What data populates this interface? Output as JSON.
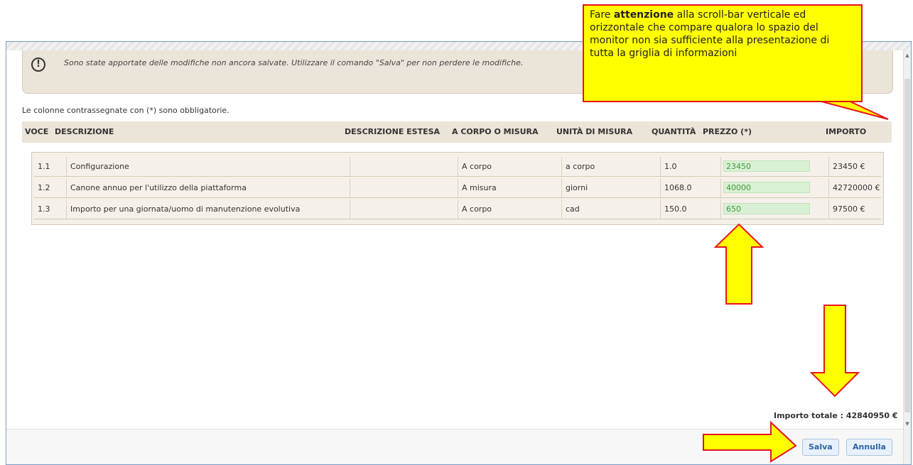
{
  "warning": {
    "message": "Sono state apportate delle modifiche non ancora salvate. Utilizzare il comando \"Salva\" per non perdere le modifiche.",
    "icon": "exclamation-circle-icon"
  },
  "note": "Le colonne contrassegnate con (*) sono obbligatorie.",
  "table": {
    "columns": [
      "VOCE",
      "DESCRIZIONE",
      "DESCRIZIONE ESTESA",
      "A CORPO O MISURA",
      "UNITÀ  DI  MISURA",
      "QUANTITÀ",
      "PREZZO (*)",
      "IMPORTO"
    ],
    "rows": [
      {
        "voce": "1.1",
        "descrizione": "Configurazione",
        "estesa": "",
        "corpo_misura": "A corpo",
        "unita": "a corpo",
        "quantita": "1.0",
        "prezzo": "23450",
        "importo": "23450 €"
      },
      {
        "voce": "1.2",
        "descrizione": "Canone annuo per l'utilizzo della piattaforma",
        "estesa": "",
        "corpo_misura": "A misura",
        "unita": "giorni",
        "quantita": "1068.0",
        "prezzo": "40000",
        "importo": "42720000 €"
      },
      {
        "voce": "1.3",
        "descrizione": "Importo per una giornata/uomo di manutenzione evolutiva",
        "estesa": "",
        "corpo_misura": "A corpo",
        "unita": "cad",
        "quantita": "150.0",
        "prezzo": "650",
        "importo": "97500 €"
      }
    ]
  },
  "total": "Importo totale : 42840950  €",
  "buttons": {
    "save": "Salva",
    "cancel": "Annulla"
  },
  "callout": {
    "before": "Fare ",
    "bold": "attenzione",
    "after": " alla scroll-bar verticale ed orizzontale che compare qualora lo spazio del monitor non sia sufficiente alla presentazione di tutta la griglia di informazioni"
  },
  "colors": {
    "accent_arrow": "#ffff00",
    "arrow_border": "#e8141b",
    "price_fill": "#d9f0d5",
    "header_bg": "#ebe4d8"
  }
}
